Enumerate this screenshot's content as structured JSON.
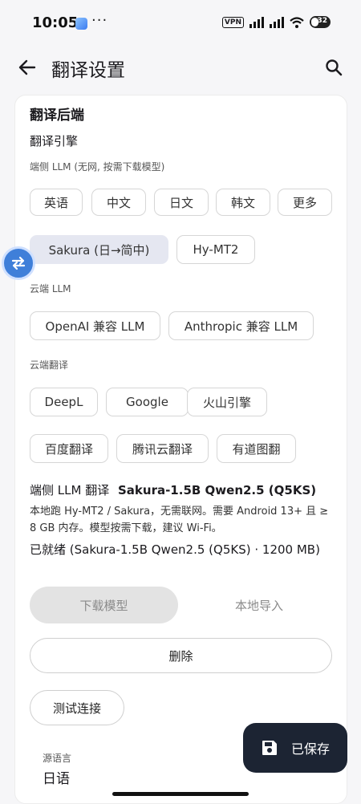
{
  "status_bar": {
    "time": "10:05",
    "dots": "···",
    "vpn": "VPN",
    "battery": "32"
  },
  "app_bar": {
    "title": "翻译设置"
  },
  "backend": {
    "section_title": "翻译后端",
    "engine_label": "翻译引擎",
    "local_llm_label": "端侧 LLM (无网, 按需下载模型)",
    "lang_chips": [
      "英语",
      "中文",
      "日文",
      "韩文",
      "更多"
    ],
    "local_models": [
      "Sakura (日→简中)",
      "Hy-MT2"
    ],
    "selected_local_model": "Sakura (日→简中)",
    "cloud_llm_label": "云端 LLM",
    "cloud_llm": [
      "OpenAI 兼容 LLM",
      "Anthropic 兼容 LLM"
    ],
    "cloud_translate_label": "云端翻译",
    "cloud_translate_row1": [
      "DeepL",
      "Google",
      "火山引擎"
    ],
    "cloud_translate_row2": [
      "百度翻译",
      "腾讯云翻译",
      "有道图翻"
    ]
  },
  "local_translation": {
    "label": "端侧 LLM 翻译",
    "model": "Sakura-1.5B Qwen2.5 (Q5KS)",
    "description": "本地跑 Hy-MT2 / Sakura，无需联网。需要 Android 13+ 且 ≥ 8 GB 内存。模型按需下载，建议 Wi-Fi。",
    "status": "已就绪 (Sakura-1.5B Qwen2.5 (Q5KS) · 1200 MB)",
    "download_label": "下载模型",
    "import_label": "本地导入",
    "delete_label": "删除",
    "test_label": "测试连接"
  },
  "source_language": {
    "label": "源语言",
    "value": "日语"
  },
  "saved_button": {
    "label": "已保存"
  },
  "colors": {
    "accent": "#3f7fd9",
    "selected_chip": "#e5e7f1",
    "dark_button": "#1c2433"
  },
  "icons": {
    "back": "arrow-left-icon",
    "search": "search-icon",
    "swap": "swap-icon",
    "save": "save-icon"
  }
}
